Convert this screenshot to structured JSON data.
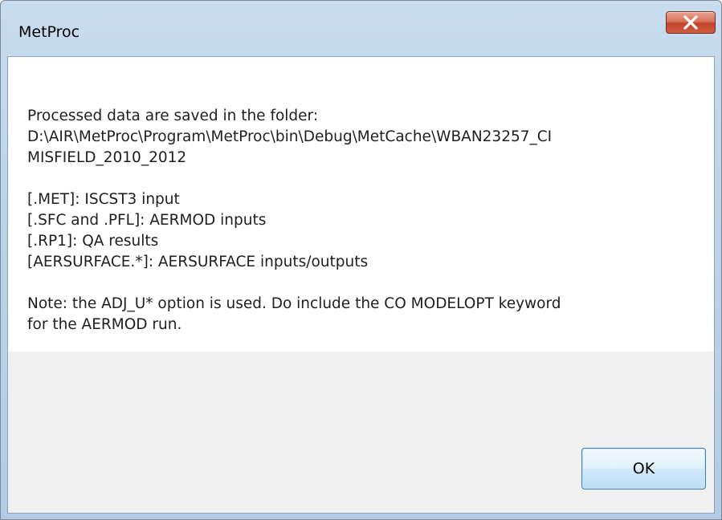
{
  "window": {
    "title": "MetProc"
  },
  "titlebar": {
    "close_icon": "close-x-icon"
  },
  "message": {
    "line1": "Processed data are saved in the folder:",
    "line2": "D:\\AIR\\MetProc\\Program\\MetProc\\bin\\Debug\\MetCache\\WBAN23257_CI",
    "line3": "MISFIELD_2010_2012",
    "line4": "[.MET]: ISCST3 input",
    "line5": "[.SFC and .PFL]: AERMOD inputs",
    "line6": "[.RP1]: QA results",
    "line7": "[AERSURFACE.*]: AERSURFACE inputs/outputs",
    "line8": "Note: the ADJ_U* option is used. Do include the CO MODELOPT keyword",
    "line9": "for the AERMOD run."
  },
  "buttons": {
    "ok_label": "OK"
  },
  "colors": {
    "close_button": "#c9553a",
    "ok_button_border": "#3c7fb1",
    "footer_background": "#f0f0f0"
  }
}
